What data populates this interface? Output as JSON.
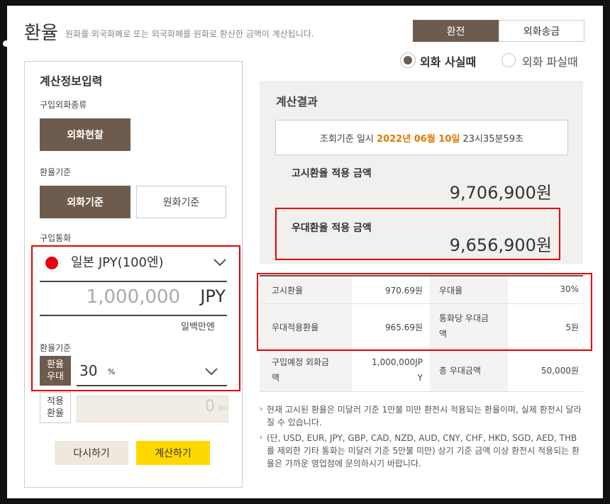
{
  "header": {
    "title": "환율",
    "description": "원화를 외국화폐로 또는 외국화폐를 원화로 환산한 금액이 계산됩니다."
  },
  "tabs": [
    "환전",
    "외화송금"
  ],
  "radios": [
    {
      "label": "외화 사실때",
      "selected": true
    },
    {
      "label": "외화 파실때",
      "selected": false
    }
  ],
  "left": {
    "title": "계산정보입력",
    "currency_type_label": "구입외화종류",
    "currency_type_btn": "외화현찰",
    "rate_basis_label": "환율기준",
    "basis_foreign": "외화기준",
    "basis_krw": "원화기준",
    "currency_label": "구입통화",
    "currency_select": "일본 JPY(100엔)",
    "amount": "1,000,000",
    "amount_unit": "JPY",
    "amount_words": "일백만엔",
    "discount_section_label": "환율기준",
    "discount_tag": "환율\n우대",
    "discount_value": "30",
    "discount_unit": "%",
    "applied_tag": "적용\n환율",
    "applied_value": "0",
    "applied_decimal": ".00",
    "reset_button": "다시하기",
    "calc_button": "계산하기"
  },
  "result": {
    "title": "계산결과",
    "query_prefix": "조회기준 일시",
    "query_date": "2022년 06월 10일",
    "query_time": "23시35분59초",
    "notice_label": "고시환율 적용 금액",
    "notice_amount": "9,706,900원",
    "pref_label": "우대환율 적용 금액",
    "pref_amount": "9,656,900원"
  },
  "table": [
    [
      "고시환율",
      "970.69원",
      "우대율",
      "30%"
    ],
    [
      "우대적용환율",
      "965.69원",
      "통화당 우대금\n액",
      "5원"
    ],
    [
      "구입예정 외화금\n액",
      "1,000,000JP\nY",
      "총 우대금액",
      "50,000원"
    ]
  ],
  "notes": [
    "현재 고시된 환율은 미달러 기준 1만불 미만 환전시 적용되는 환율이며, 실제 환전시 달라질 수 있습니다.",
    "(단, USD, EUR, JPY, GBP, CAD, NZD, AUD, CNY, CHF, HKD, SGD, AED, THB를 제외한 기타 통화는 미달러 기준 5만불 미만) 상기 기준 금액 이상 환전시 적용되는 환율은 가까운 영업점에 문의하시기 바랍니다."
  ],
  "colors": {
    "accent_brown": "#6d5c4d",
    "highlight_orange": "#e07b00",
    "calc_yellow": "#ffd800",
    "annotation_red": "#e60000"
  },
  "icons": [
    "japan-flag-icon",
    "chevron-down-icon",
    "radio-icon",
    "bullet-arrow-icon"
  ]
}
